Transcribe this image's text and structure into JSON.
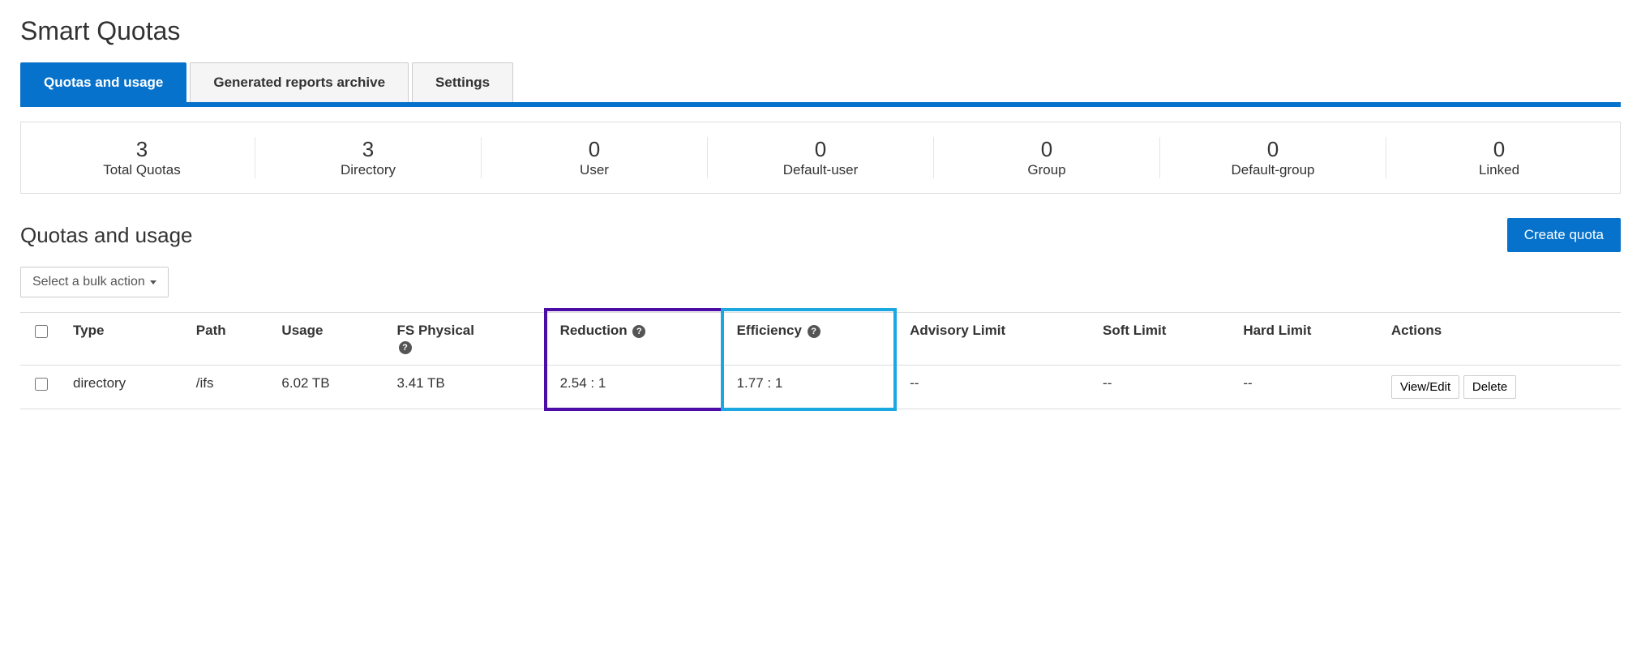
{
  "page_title": "Smart Quotas",
  "tabs": [
    {
      "label": "Quotas and usage",
      "active": true
    },
    {
      "label": "Generated reports archive",
      "active": false
    },
    {
      "label": "Settings",
      "active": false
    }
  ],
  "stats": [
    {
      "value": "3",
      "label": "Total Quotas"
    },
    {
      "value": "3",
      "label": "Directory"
    },
    {
      "value": "0",
      "label": "User"
    },
    {
      "value": "0",
      "label": "Default-user"
    },
    {
      "value": "0",
      "label": "Group"
    },
    {
      "value": "0",
      "label": "Default-group"
    },
    {
      "value": "0",
      "label": "Linked"
    }
  ],
  "section_title": "Quotas and usage",
  "create_button": "Create quota",
  "bulk_action_label": "Select a bulk action",
  "columns": {
    "type": "Type",
    "path": "Path",
    "usage": "Usage",
    "fs_physical": "FS Physical",
    "reduction": "Reduction",
    "efficiency": "Efficiency",
    "advisory_limit": "Advisory Limit",
    "soft_limit": "Soft Limit",
    "hard_limit": "Hard Limit",
    "actions": "Actions"
  },
  "rows": [
    {
      "type": "directory",
      "path": "/ifs",
      "usage": "6.02 TB",
      "fs_physical": "3.41 TB",
      "reduction": "2.54 : 1",
      "efficiency": "1.77 : 1",
      "advisory_limit": "--",
      "soft_limit": "--",
      "hard_limit": "--"
    }
  ],
  "row_actions": {
    "view_edit": "View/Edit",
    "delete": "Delete"
  },
  "help_glyph": "?"
}
